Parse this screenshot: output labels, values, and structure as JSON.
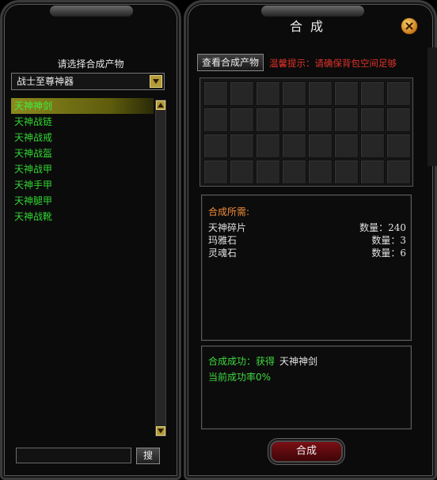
{
  "left_panel": {
    "select_title": "请选择合成产物",
    "category_selected": "战士至尊神器",
    "items": [
      {
        "label": "天神神剑",
        "selected": true
      },
      {
        "label": "天神战链",
        "selected": false
      },
      {
        "label": "天神战戒",
        "selected": false
      },
      {
        "label": "天神战盔",
        "selected": false
      },
      {
        "label": "天神战甲",
        "selected": false
      },
      {
        "label": "天神手甲",
        "selected": false
      },
      {
        "label": "天神腿甲",
        "selected": false
      },
      {
        "label": "天神战靴",
        "selected": false
      }
    ],
    "search_value": "",
    "search_button_label": "搜"
  },
  "right_panel": {
    "title": "合成",
    "view_products_label": "查看合成产物",
    "tip": "温馨提示：请确保背包空间足够",
    "requirements": {
      "title": "合成所需:",
      "rows": [
        {
          "name": "天神碎片",
          "qty": "数量：240"
        },
        {
          "name": "玛雅石",
          "qty": "数量：3"
        },
        {
          "name": "灵魂石",
          "qty": "数量：6"
        }
      ]
    },
    "result": {
      "success_label": "合成成功：获得",
      "success_item": "天神神剑",
      "rate": "当前成功率0%"
    },
    "synthesize_label": "合成"
  },
  "colors": {
    "list_text": "#31d631",
    "tip_red": "#e0322a",
    "req_title_orange": "#f08c3a",
    "button_red": "#7a0f14"
  },
  "icons": {
    "dropdown": "chevron-down-icon",
    "close": "close-icon",
    "scroll_up": "chevron-up-icon",
    "scroll_down": "chevron-down-icon"
  }
}
